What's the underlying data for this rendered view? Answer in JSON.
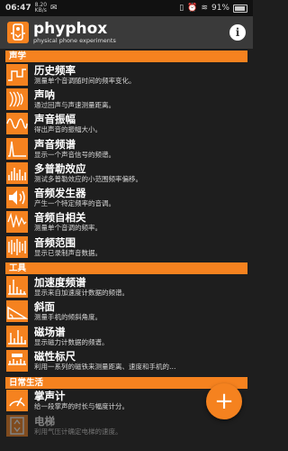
{
  "status": {
    "time": "06:47",
    "speed_value": "8.20",
    "speed_unit": "KB/s",
    "battery": "91%"
  },
  "header": {
    "app_name": "phyphox",
    "subtitle": "physical phone experiments"
  },
  "categories": [
    {
      "name": "声学",
      "items": [
        {
          "title": "历史频率",
          "desc": "测量单个音调随时间的频率变化。",
          "icon": "frequency-history-icon"
        },
        {
          "title": "声呐",
          "desc": "通过回声与声速测量距离。",
          "icon": "sonar-icon"
        },
        {
          "title": "声音振幅",
          "desc": "得出声音的振幅大小。",
          "icon": "sound-amplitude-icon"
        },
        {
          "title": "声音频谱",
          "desc": "显示一个声音信号的频谱。",
          "icon": "audio-spectrum-icon"
        },
        {
          "title": "多普勒效应",
          "desc": "测试多普勒效应的小范围频率偏移。",
          "icon": "doppler-icon"
        },
        {
          "title": "音频发生器",
          "desc": "产生一个特定频率的音调。",
          "icon": "tone-generator-icon"
        },
        {
          "title": "音频自相关",
          "desc": "测量单个音调的频率。",
          "icon": "audio-autocorrelation-icon"
        },
        {
          "title": "音频范围",
          "desc": "显示已录制声音数据。",
          "icon": "audio-scope-icon"
        }
      ]
    },
    {
      "name": "工具",
      "items": [
        {
          "title": "加速度频谱",
          "desc": "显示来自加速度计数据的频谱。",
          "icon": "acceleration-spectrum-icon"
        },
        {
          "title": "斜面",
          "desc": "测量手机的倾斜角度。",
          "icon": "inclination-icon"
        },
        {
          "title": "磁场谱",
          "desc": "显示磁力计数据的频谱。",
          "icon": "magnetic-spectrum-icon"
        },
        {
          "title": "磁性标尺",
          "desc": "利用一系列的磁铁来测量距离、速度和手机的…",
          "icon": "magnetic-ruler-icon"
        }
      ]
    },
    {
      "name": "日常生活",
      "items": [
        {
          "title": "掌声计",
          "desc": "给一段掌声的时长与幅度计分。",
          "icon": "applause-meter-icon"
        },
        {
          "title": "电梯",
          "desc": "利用气压计确定电梯的速度。",
          "icon": "elevator-icon"
        }
      ]
    }
  ],
  "fab": {
    "label": "+"
  },
  "colors": {
    "accent": "#f5821f",
    "background": "#1e1e1e",
    "header": "#3a3a3a"
  }
}
